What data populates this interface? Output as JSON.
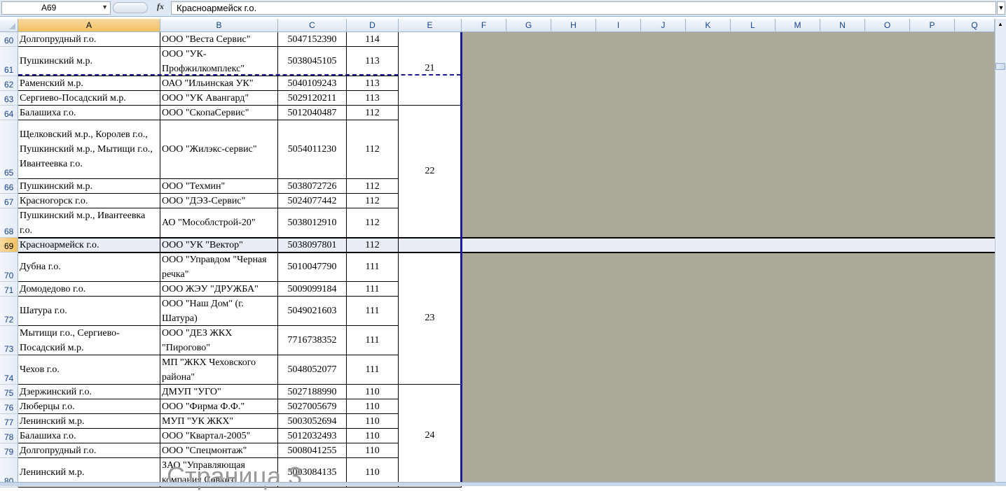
{
  "formula_bar": {
    "name_box": "A69",
    "fx_label": "fx",
    "formula": "Красноармейск г.о."
  },
  "columns": [
    "A",
    "B",
    "C",
    "D",
    "E",
    "F",
    "G",
    "H",
    "I",
    "J",
    "K",
    "L",
    "M",
    "N",
    "O",
    "P",
    "Q"
  ],
  "selected_row": "69",
  "rows": [
    {
      "num": "60",
      "a": "Долгопрудный г.о.",
      "b": "ООО \"Веста Сервис\"",
      "c": "5047152390",
      "d": "114"
    },
    {
      "num": "61",
      "a": "Пушкинский м.р.",
      "b": "ООО \"УК-Профжилкомплекс\"",
      "c": "5038045105",
      "d": "113"
    },
    {
      "num": "62",
      "a": "Раменский м.р.",
      "b": "ОАО \"Ильинская УК\"",
      "c": "5040109243",
      "d": "113"
    },
    {
      "num": "63",
      "a": "Сергиево-Посадский м.р.",
      "b": "ООО \"УК Авангард\"",
      "c": "5029120211",
      "d": "113"
    },
    {
      "num": "64",
      "a": "Балашиха г.о.",
      "b": "ООО \"СкопаСервис\"",
      "c": "5012040487",
      "d": "112"
    },
    {
      "num": "65",
      "a": "Щелковский м.р., Королев г.о., Пушкинский м.р., Мытищи г.о., Ивантеевка г.о.",
      "b": "ООО \"Жилэкс-сервис\"",
      "c": "5054011230",
      "d": "112"
    },
    {
      "num": "66",
      "a": "Пушкинский м.р.",
      "b": "ООО \"Техмин\"",
      "c": "5038072726",
      "d": "112"
    },
    {
      "num": "67",
      "a": "Красногорск г.о.",
      "b": "ООО \"ДЭЗ-Сервис\"",
      "c": "5024077442",
      "d": "112"
    },
    {
      "num": "68",
      "a": "Пушкинский м.р., Ивантеевка г.о.",
      "b": "АО \"Мособлстрой-20\"",
      "c": "5038012910",
      "d": "112"
    },
    {
      "num": "69",
      "a": "Красноармейск г.о.",
      "b": "ООО \"УК \"Вектор\"",
      "c": "5038097801",
      "d": "112"
    },
    {
      "num": "70",
      "a": "Дубна г.о.",
      "b": "ООО \"Управдом \"Черная речка\"",
      "c": "5010047790",
      "d": "111"
    },
    {
      "num": "71",
      "a": "Домодедово г.о.",
      "b": "ООО ЖЭУ \"ДРУЖБА\"",
      "c": "5009099184",
      "d": "111"
    },
    {
      "num": "72",
      "a": "Шатура г.о.",
      "b": "ООО \"Наш Дом\" (г. Шатура)",
      "c": "5049021603",
      "d": "111"
    },
    {
      "num": "73",
      "a": "Мытищи г.о., Сергиево-Посадский м.р.",
      "b": "ООО \"ДЕЗ ЖКХ \"Пирогово\"",
      "c": "7716738352",
      "d": "111"
    },
    {
      "num": "74",
      "a": "Чехов г.о.",
      "b": "МП \"ЖКХ Чеховского района\"",
      "c": "5048052077",
      "d": "111"
    },
    {
      "num": "75",
      "a": "Дзержинский г.о.",
      "b": "ДМУП \"УГО\"",
      "c": "5027188990",
      "d": "110"
    },
    {
      "num": "76",
      "a": "Люберцы г.о.",
      "b": "ООО \"Фирма Ф.Ф.\"",
      "c": "5027005679",
      "d": "110"
    },
    {
      "num": "77",
      "a": "Ленинский м.р.",
      "b": "МУП \"УК ЖКХ\"",
      "c": "5003052694",
      "d": "110"
    },
    {
      "num": "78",
      "a": "Балашиха г.о.",
      "b": "ООО \"Квартал-2005\"",
      "c": "5012032493",
      "d": "110"
    },
    {
      "num": "79",
      "a": "Долгопрудный г.о.",
      "b": "ООО \"Спецмонтаж\"",
      "c": "5008041255",
      "d": "110"
    },
    {
      "num": "80",
      "a": "Ленинский м.р.",
      "b": "ЗАО \"Управляющая компания Совхоз",
      "c": "5003084135",
      "d": "110"
    }
  ],
  "merged_e": [
    {
      "label": "21"
    },
    {
      "label": "22"
    },
    {
      "label": "23"
    },
    {
      "label": "24"
    }
  ],
  "page_watermark": "Страница 3"
}
